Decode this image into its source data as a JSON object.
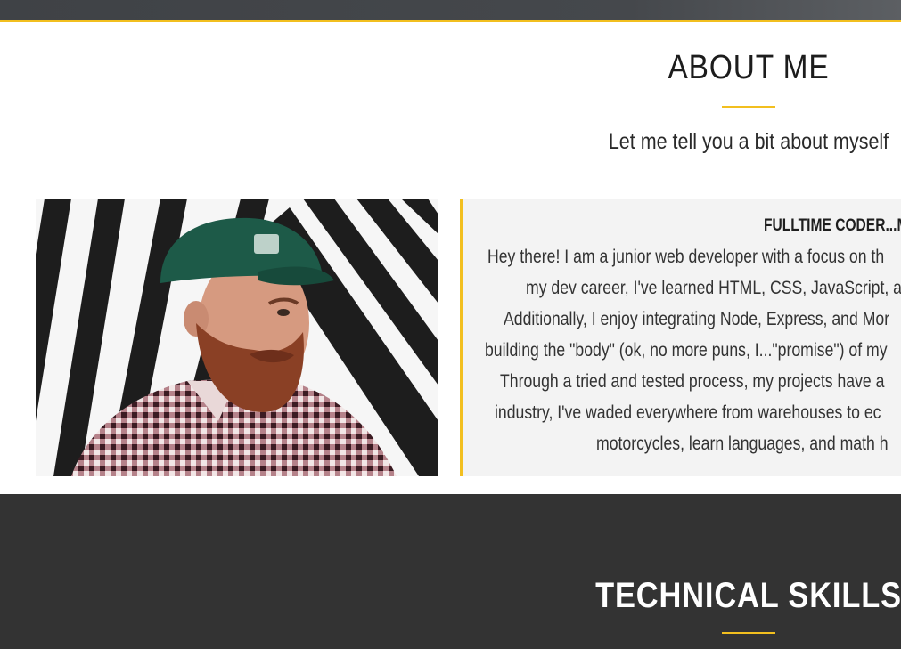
{
  "colors": {
    "accent": "#f2bf1f",
    "dark_section": "#333333",
    "card_bg": "#f3f3f3"
  },
  "about": {
    "title": "ABOUT ME",
    "subtitle": "Let me tell you a bit about myself",
    "photo_icon": "portrait-photo",
    "card": {
      "heading": "FULLTIME CODER...M",
      "lines": [
        "Hey there! I am a junior web developer with a focus on th",
        "my dev career, I've learned HTML, CSS, JavaScript, a",
        "Additionally, I enjoy integrating Node, Express, and Mor",
        "building the \"body\" (ok, no more puns, I...\"promise\") of my",
        "Through a tried and tested process, my projects have a",
        "industry, I've waded everywhere from warehouses to ec",
        "motorcycles, learn languages, and math h"
      ]
    }
  },
  "skills": {
    "title": "TECHNICAL SKILLS"
  }
}
